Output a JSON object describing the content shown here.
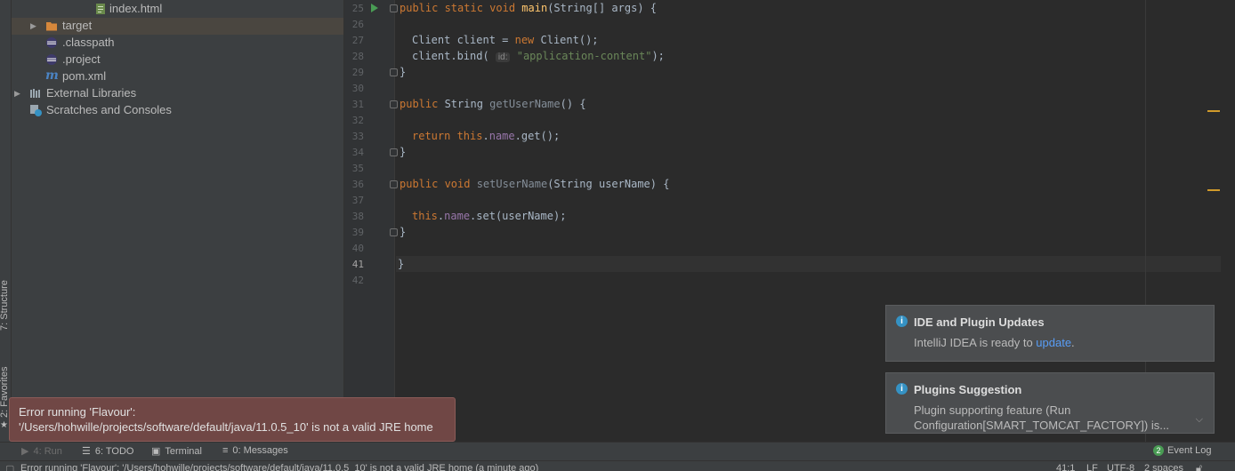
{
  "left_strip": {
    "structure_tab": "7: Structure",
    "favorites_tab": "2: Favorites"
  },
  "project_tree": {
    "items": [
      {
        "label": "index.html",
        "icon": "html-file-icon"
      },
      {
        "label": "target",
        "icon": "folder-icon"
      },
      {
        "label": ".classpath",
        "icon": "eclipse-file-icon"
      },
      {
        "label": ".project",
        "icon": "eclipse-file-icon"
      },
      {
        "label": "pom.xml",
        "icon": "maven-file-icon"
      },
      {
        "label": "External Libraries",
        "icon": "libraries-icon"
      },
      {
        "label": "Scratches and Consoles",
        "icon": "scratches-icon"
      }
    ]
  },
  "editor": {
    "line_numbers": [
      "25",
      "26",
      "27",
      "28",
      "29",
      "30",
      "31",
      "32",
      "33",
      "34",
      "35",
      "36",
      "37",
      "38",
      "39",
      "40",
      "41",
      "42"
    ],
    "current_line": "41",
    "inlay_hint": "id:",
    "code": {
      "l25": {
        "kw1": "public static void ",
        "fn": "main",
        "rest": "(String[] args) {"
      },
      "l27": {
        "pre": "Client client = ",
        "kw": "new",
        "post": " Client();"
      },
      "l28": {
        "pre": "client.bind( ",
        "str": "\"application-content\"",
        "post": ");"
      },
      "l29": "}",
      "l31": {
        "kw": "public ",
        "type": "String ",
        "fn": "getUserName",
        "rest": "() {"
      },
      "l33": {
        "kw": "return this",
        "dot": ".",
        "fld": "name",
        "rest": ".get();"
      },
      "l34": "}",
      "l36": {
        "kw": "public void ",
        "fn": "setUserName",
        "rest": "(String userName) {"
      },
      "l38": {
        "kw": "this",
        "dot": ".",
        "fld": "name",
        "rest": ".set(userName);"
      },
      "l39": "}",
      "l41": "}"
    }
  },
  "notifications": [
    {
      "title": "IDE and Plugin Updates",
      "body_pre": "IntelliJ IDEA is ready to ",
      "link": "update",
      "body_post": "."
    },
    {
      "title": "Plugins Suggestion",
      "line1": "Plugin supporting feature (Run",
      "line2": "Configuration[SMART_TOMCAT_FACTORY]) is..."
    }
  ],
  "error_balloon": {
    "line1": "Error running 'Flavour':",
    "line2": "'/Users/hohwille/projects/software/default/java/11.0.5_10' is not a valid JRE home"
  },
  "bottom_tabs": {
    "run": "4: Run",
    "todo": "6: TODO",
    "terminal": "Terminal",
    "messages": "0: Messages",
    "event_log": "Event Log",
    "event_count": "2"
  },
  "status_bar": {
    "message": "Error running 'Flavour': '/Users/hohwille/projects/software/default/java/11.0.5_10' is not a valid JRE home (a minute ago)",
    "position": "41:1",
    "line_sep": "LF",
    "encoding": "UTF-8",
    "indent": "2 spaces"
  },
  "colors": {
    "editor_bg": "#2b2b2b",
    "panel_bg": "#3c3f41",
    "keyword": "#cc7832",
    "function": "#ffc66d",
    "field": "#9876aa",
    "string": "#6a8759",
    "error_balloon": "#704745",
    "link": "#589df6"
  }
}
